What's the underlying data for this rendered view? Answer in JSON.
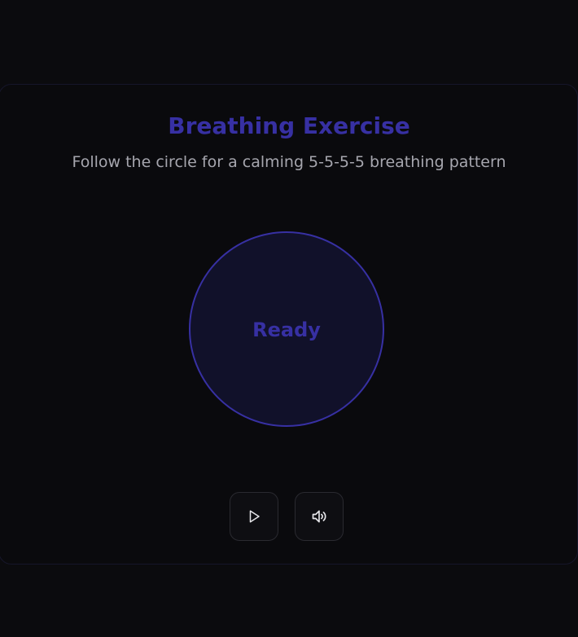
{
  "header": {
    "title": "Breathing Exercise",
    "subtitle": "Follow the circle for a calming 5-5-5-5 breathing pattern"
  },
  "breathing_circle": {
    "state_label": "Ready"
  },
  "controls": {
    "play_icon": "play-icon",
    "sound_icon": "volume-icon"
  },
  "colors": {
    "accent": "#3730a3",
    "background": "#0b0b0e",
    "subtitle_text": "#a6a6ae",
    "circle_fill": "#11112a"
  }
}
